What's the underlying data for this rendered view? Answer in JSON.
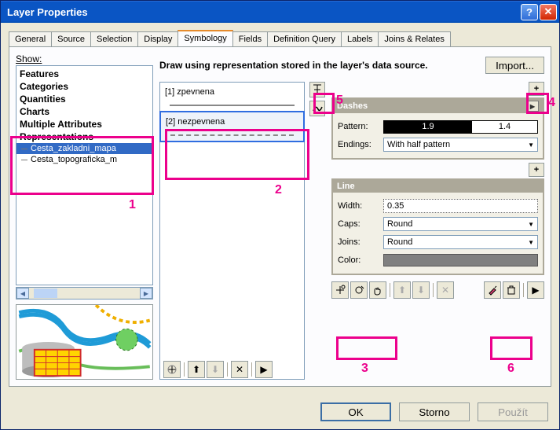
{
  "window": {
    "title": "Layer Properties"
  },
  "tabs": {
    "items": [
      "General",
      "Source",
      "Selection",
      "Display",
      "Symbology",
      "Fields",
      "Definition Query",
      "Labels",
      "Joins & Relates"
    ],
    "active": "Symbology"
  },
  "show": {
    "label": "Show:",
    "categories": [
      "Features",
      "Categories",
      "Quantities",
      "Charts",
      "Multiple Attributes",
      "Representations"
    ],
    "rep_items": [
      "Cesta_zakladni_mapa",
      "Cesta_topograficka_m"
    ]
  },
  "header": {
    "desc": "Draw using representation stored in the layer's data source.",
    "import": "Import..."
  },
  "rules": {
    "items": [
      {
        "id": "[1]",
        "name": "zpevnena"
      },
      {
        "id": "[2]",
        "name": "nezpevnena"
      }
    ],
    "selected": 1
  },
  "dashes": {
    "title": "Dashes",
    "pattern_label": "Pattern:",
    "pattern_dark": "1.9",
    "pattern_light": "1.4",
    "endings_label": "Endings:",
    "endings_value": "With half pattern"
  },
  "line": {
    "title": "Line",
    "width_label": "Width:",
    "width_value": "0.35",
    "caps_label": "Caps:",
    "caps_value": "Round",
    "joins_label": "Joins:",
    "joins_value": "Round",
    "color_label": "Color:",
    "color_value": "#808080"
  },
  "buttons": {
    "ok": "OK",
    "cancel": "Storno",
    "apply": "Použít"
  },
  "callouts": {
    "1": "1",
    "2": "2",
    "3": "3",
    "4": "4",
    "5": "5",
    "6": "6"
  }
}
